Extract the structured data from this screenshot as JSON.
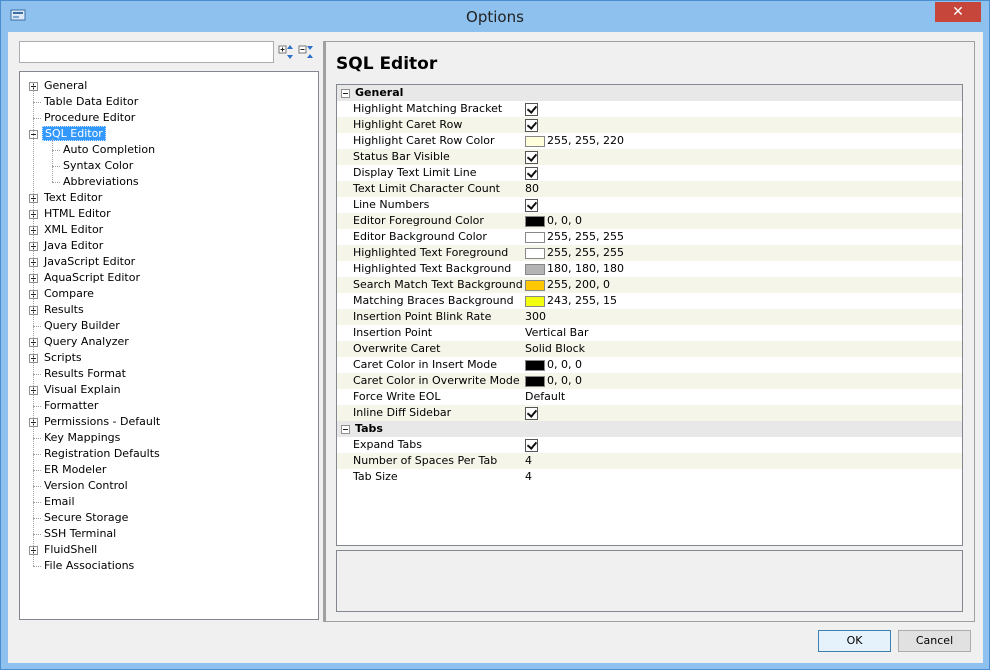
{
  "window": {
    "title": "Options",
    "close_label": "✕"
  },
  "search": {
    "value": "",
    "placeholder": ""
  },
  "tree": [
    {
      "label": "General",
      "expander": "plus",
      "level": 0
    },
    {
      "label": "Table Data Editor",
      "expander": "none",
      "level": 0
    },
    {
      "label": "Procedure Editor",
      "expander": "none",
      "level": 0
    },
    {
      "label": "SQL Editor",
      "expander": "minus",
      "level": 0,
      "selected": true
    },
    {
      "label": "Auto Completion",
      "expander": "none",
      "level": 1
    },
    {
      "label": "Syntax Color",
      "expander": "none",
      "level": 1
    },
    {
      "label": "Abbreviations",
      "expander": "none",
      "level": 1
    },
    {
      "label": "Text Editor",
      "expander": "plus",
      "level": 0
    },
    {
      "label": "HTML Editor",
      "expander": "plus",
      "level": 0
    },
    {
      "label": "XML Editor",
      "expander": "plus",
      "level": 0
    },
    {
      "label": "Java Editor",
      "expander": "plus",
      "level": 0
    },
    {
      "label": "JavaScript Editor",
      "expander": "plus",
      "level": 0
    },
    {
      "label": "AquaScript Editor",
      "expander": "plus",
      "level": 0
    },
    {
      "label": "Compare",
      "expander": "plus",
      "level": 0
    },
    {
      "label": "Results",
      "expander": "plus",
      "level": 0
    },
    {
      "label": "Query Builder",
      "expander": "none",
      "level": 0
    },
    {
      "label": "Query Analyzer",
      "expander": "plus",
      "level": 0
    },
    {
      "label": "Scripts",
      "expander": "plus",
      "level": 0
    },
    {
      "label": "Results Format",
      "expander": "none",
      "level": 0
    },
    {
      "label": "Visual Explain",
      "expander": "plus",
      "level": 0
    },
    {
      "label": "Formatter",
      "expander": "none",
      "level": 0
    },
    {
      "label": "Permissions - Default",
      "expander": "plus",
      "level": 0
    },
    {
      "label": "Key Mappings",
      "expander": "none",
      "level": 0
    },
    {
      "label": "Registration Defaults",
      "expander": "none",
      "level": 0
    },
    {
      "label": "ER Modeler",
      "expander": "none",
      "level": 0
    },
    {
      "label": "Version Control",
      "expander": "none",
      "level": 0
    },
    {
      "label": "Email",
      "expander": "none",
      "level": 0
    },
    {
      "label": "Secure Storage",
      "expander": "none",
      "level": 0
    },
    {
      "label": "SSH Terminal",
      "expander": "none",
      "level": 0
    },
    {
      "label": "FluidShell",
      "expander": "plus",
      "level": 0
    },
    {
      "label": "File Associations",
      "expander": "none",
      "level": 0
    }
  ],
  "panel": {
    "title": "SQL Editor"
  },
  "groups": [
    {
      "label": "General",
      "props": [
        {
          "name": "Highlight Matching Bracket",
          "type": "check",
          "checked": true
        },
        {
          "name": "Highlight Caret Row",
          "type": "check",
          "checked": true
        },
        {
          "name": "Highlight Caret Row Color",
          "type": "color",
          "color": "#ffffdc",
          "value": "255, 255, 220"
        },
        {
          "name": "Status Bar Visible",
          "type": "check",
          "checked": true
        },
        {
          "name": "Display Text Limit Line",
          "type": "check",
          "checked": true
        },
        {
          "name": "Text Limit Character Count",
          "type": "text",
          "value": "80"
        },
        {
          "name": "Line Numbers",
          "type": "check",
          "checked": true
        },
        {
          "name": "Editor Foreground Color",
          "type": "color",
          "color": "#000000",
          "value": "0, 0, 0"
        },
        {
          "name": "Editor Background Color",
          "type": "color",
          "color": "#ffffff",
          "value": "255, 255, 255"
        },
        {
          "name": "Highlighted Text Foreground",
          "type": "color",
          "color": "#ffffff",
          "value": "255, 255, 255"
        },
        {
          "name": "Highlighted Text Background",
          "type": "color",
          "color": "#b4b4b4",
          "value": "180, 180, 180"
        },
        {
          "name": "Search Match Text Background",
          "type": "color",
          "color": "#ffc800",
          "value": "255, 200, 0"
        },
        {
          "name": "Matching Braces Background",
          "type": "color",
          "color": "#f3ff0f",
          "value": "243, 255, 15"
        },
        {
          "name": "Insertion Point Blink Rate",
          "type": "text",
          "value": "300"
        },
        {
          "name": "Insertion Point",
          "type": "text",
          "value": "Vertical Bar"
        },
        {
          "name": "Overwrite Caret",
          "type": "text",
          "value": "Solid Block"
        },
        {
          "name": "Caret Color in Insert Mode",
          "type": "color",
          "color": "#000000",
          "value": "0, 0, 0"
        },
        {
          "name": "Caret Color in Overwrite Mode",
          "type": "color",
          "color": "#000000",
          "value": "0, 0, 0"
        },
        {
          "name": "Force Write EOL",
          "type": "text",
          "value": "Default"
        },
        {
          "name": "Inline Diff Sidebar",
          "type": "check",
          "checked": true
        }
      ]
    },
    {
      "label": "Tabs",
      "props": [
        {
          "name": "Expand Tabs",
          "type": "check",
          "checked": true
        },
        {
          "name": "Number of Spaces Per Tab",
          "type": "text",
          "value": "4"
        },
        {
          "name": "Tab Size",
          "type": "text",
          "value": "4"
        }
      ]
    }
  ],
  "buttons": {
    "ok": "OK",
    "cancel": "Cancel"
  }
}
